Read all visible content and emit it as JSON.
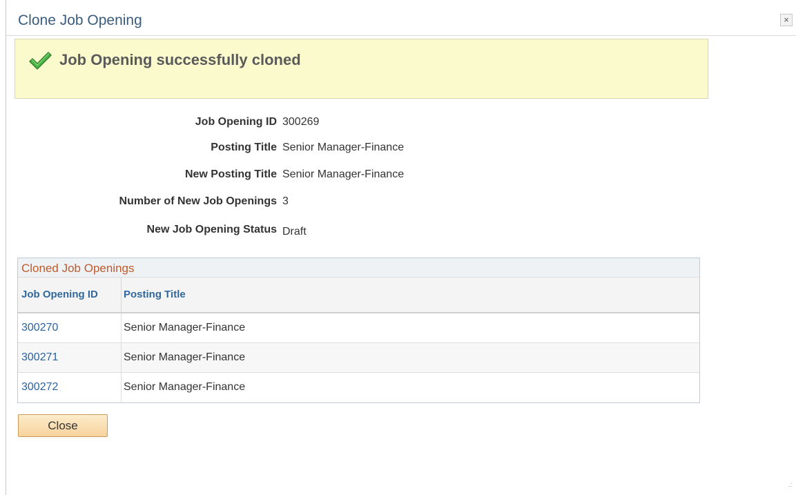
{
  "dialog": {
    "title": "Clone Job Opening",
    "close_glyph": "×"
  },
  "message": {
    "icon": "checkmark-icon",
    "text": "Job Opening successfully cloned",
    "color_icon": "#2e9a35"
  },
  "fields": [
    {
      "label": "Job Opening ID",
      "value": "300269"
    },
    {
      "label": "Posting Title",
      "value": "Senior Manager-Finance"
    },
    {
      "label": "New Posting Title",
      "value": "Senior Manager-Finance"
    },
    {
      "label": "Number of New Job Openings",
      "value": "3"
    },
    {
      "label": "New Job Opening Status",
      "value": "Draft"
    }
  ],
  "grid": {
    "title": "Cloned Job Openings",
    "columns": [
      "Job Opening ID",
      "Posting Title"
    ],
    "rows": [
      {
        "id": "300270",
        "title": "Senior Manager-Finance"
      },
      {
        "id": "300271",
        "title": "Senior Manager-Finance"
      },
      {
        "id": "300272",
        "title": "Senior Manager-Finance"
      }
    ]
  },
  "buttons": {
    "close_label": "Close"
  },
  "resize_grip": ".:"
}
